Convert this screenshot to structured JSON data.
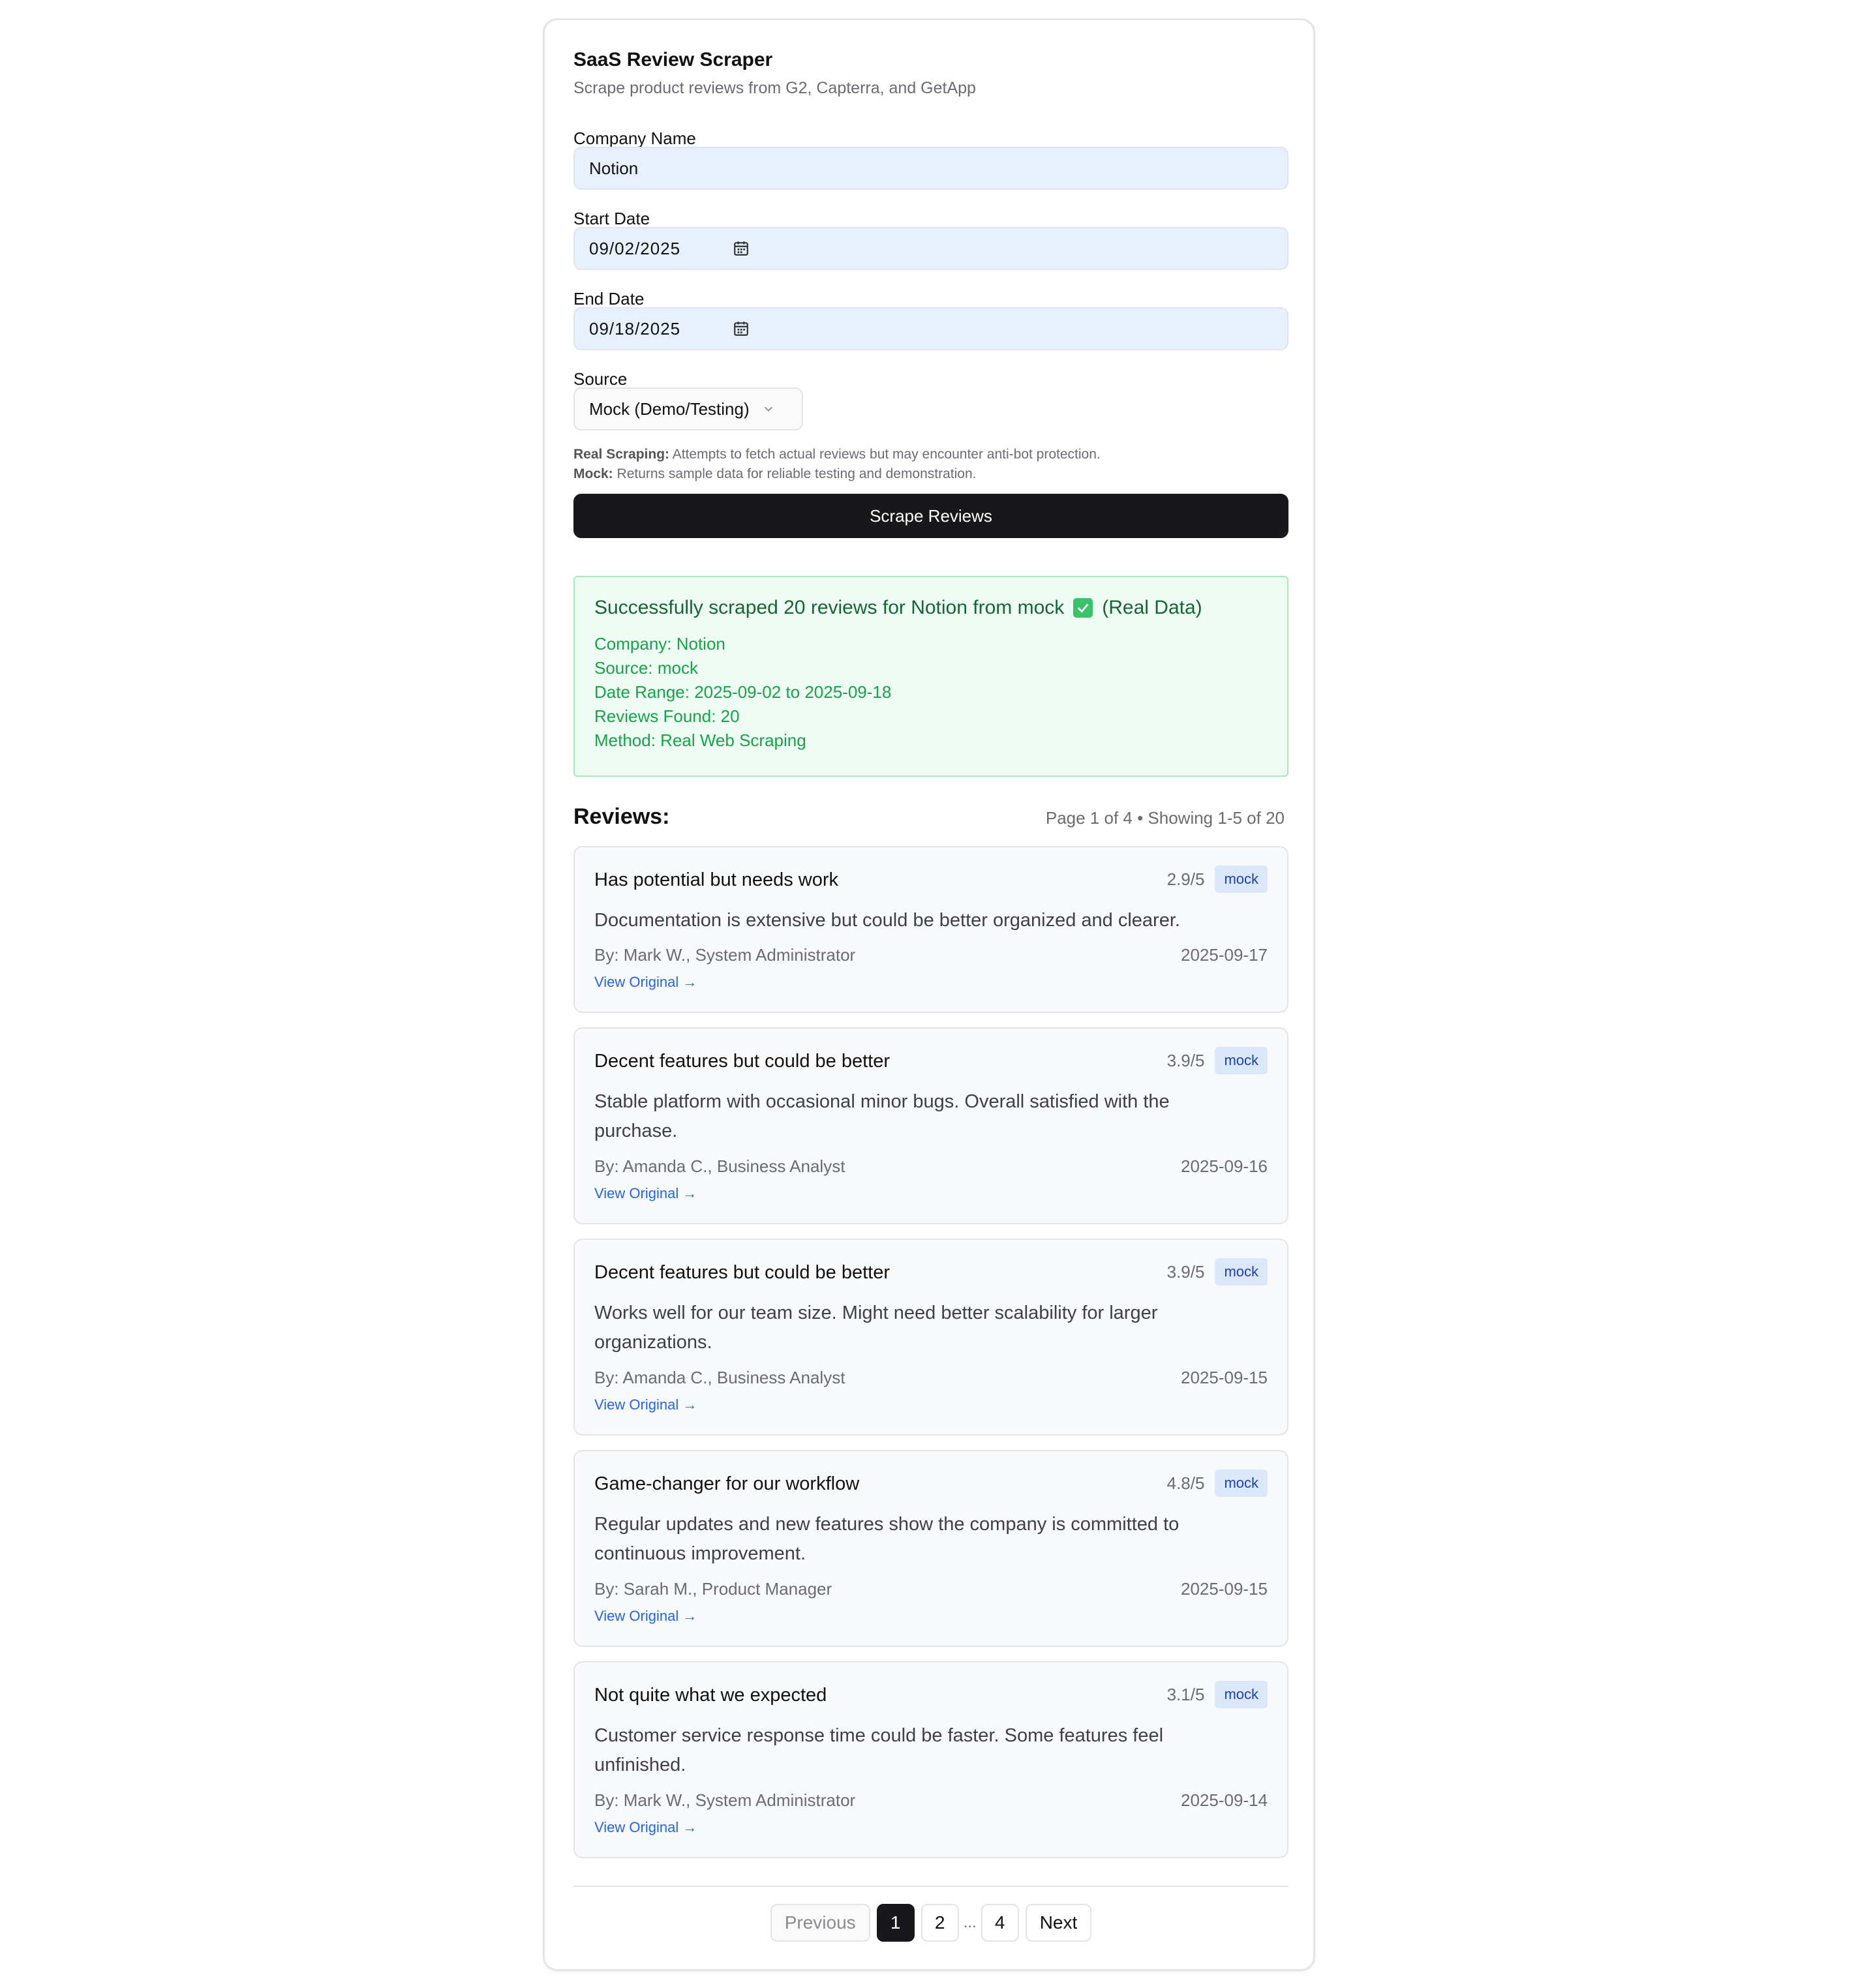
{
  "app": {
    "title": "SaaS Review Scraper",
    "subtitle": "Scrape product reviews from G2, Capterra, and GetApp"
  },
  "form": {
    "company_label": "Company Name",
    "company_value": "Notion",
    "start_label": "Start Date",
    "start_value": "09/02/2025",
    "end_label": "End Date",
    "end_value": "09/18/2025",
    "source_label": "Source",
    "source_value": "Mock (Demo/Testing)",
    "note_real_bold": "Real Scraping:",
    "note_real_text": " Attempts to fetch actual reviews but may encounter anti-bot protection.",
    "note_mock_bold": "Mock:",
    "note_mock_text": " Returns sample data for reliable testing and demonstration.",
    "submit_label": "Scrape Reviews"
  },
  "result": {
    "headline": "Successfully scraped 20 reviews for Notion from mock",
    "headline_suffix": "(Real Data)",
    "lines": [
      "Company: Notion",
      "Source: mock",
      "Date Range: 2025-09-02 to 2025-09-18",
      "Reviews Found: 20",
      "Method: Real Web Scraping"
    ]
  },
  "reviews": {
    "heading": "Reviews:",
    "page_info": "Page 1 of 4 • Showing 1-5 of 20",
    "items": [
      {
        "title": "Has potential but needs work",
        "rating": "2.9/5",
        "badge": "mock",
        "body": "Documentation is extensive but could be better organized and clearer.",
        "author": "By: Mark W., System Administrator",
        "date": "2025-09-17",
        "link": "View Original →"
      },
      {
        "title": "Decent features but could be better",
        "rating": "3.9/5",
        "badge": "mock",
        "body": "Stable platform with occasional minor bugs. Overall satisfied with the purchase.",
        "author": "By: Amanda C., Business Analyst",
        "date": "2025-09-16",
        "link": "View Original →"
      },
      {
        "title": "Decent features but could be better",
        "rating": "3.9/5",
        "badge": "mock",
        "body": "Works well for our team size. Might need better scalability for larger organizations.",
        "author": "By: Amanda C., Business Analyst",
        "date": "2025-09-15",
        "link": "View Original →"
      },
      {
        "title": "Game-changer for our workflow",
        "rating": "4.8/5",
        "badge": "mock",
        "body": "Regular updates and new features show the company is committed to continuous improvement.",
        "author": "By: Sarah M., Product Manager",
        "date": "2025-09-15",
        "link": "View Original →"
      },
      {
        "title": "Not quite what we expected",
        "rating": "3.1/5",
        "badge": "mock",
        "body": "Customer service response time could be faster. Some features feel unfinished.",
        "author": "By: Mark W., System Administrator",
        "date": "2025-09-14",
        "link": "View Original →"
      }
    ]
  },
  "pagination": {
    "previous": "Previous",
    "pages": [
      "1",
      "2",
      "4"
    ],
    "ellipsis": "...",
    "next": "Next",
    "current": "1"
  }
}
